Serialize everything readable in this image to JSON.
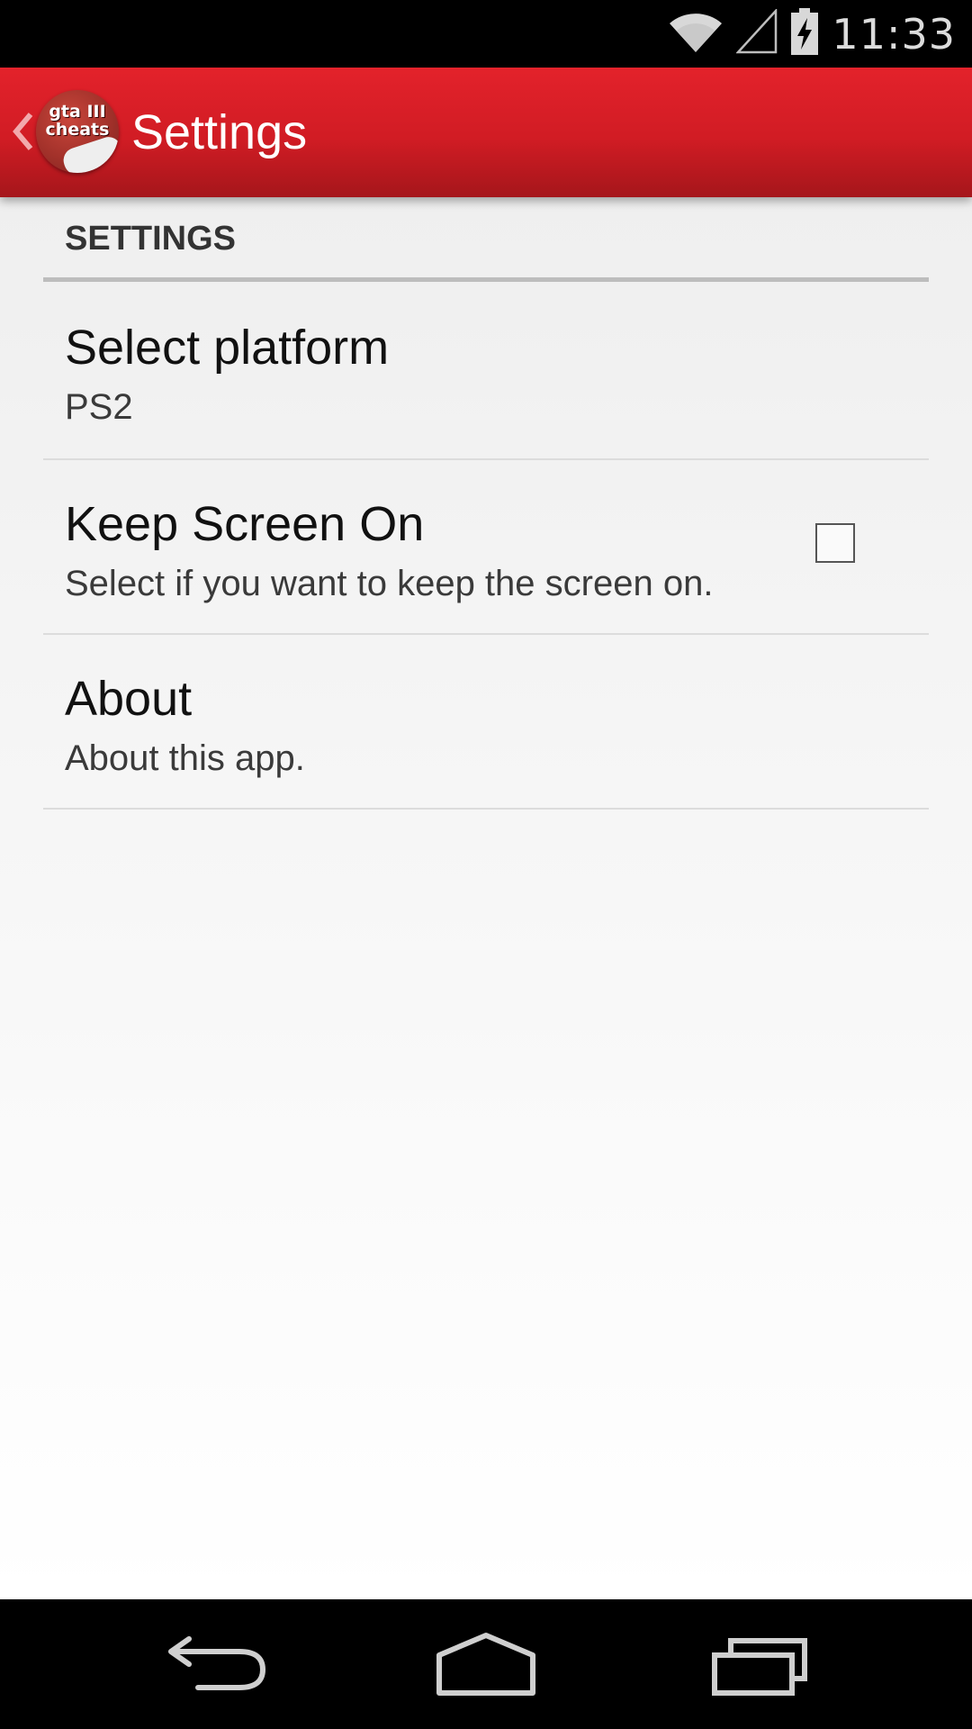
{
  "status_bar": {
    "time": "11:33",
    "icons": [
      "wifi-icon",
      "cell-signal-icon",
      "battery-charging-icon"
    ]
  },
  "action_bar": {
    "title": "Settings",
    "app_icon_text": "gta III cheats",
    "icons": [
      "back-chevron-icon",
      "app-logo-icon"
    ]
  },
  "settings": {
    "section_header": "SETTINGS",
    "items": [
      {
        "title": "Select platform",
        "summary": "PS2"
      },
      {
        "title": "Keep Screen On",
        "summary": "Select if you want to keep the screen on.",
        "checked": false
      },
      {
        "title": "About",
        "summary": "About this app."
      }
    ]
  },
  "nav_bar": {
    "icons": [
      "back-icon",
      "home-icon",
      "recent-apps-icon"
    ]
  },
  "colors": {
    "action_bar": "#e3222b",
    "status_bar": "#000000",
    "nav_bar": "#000000"
  }
}
